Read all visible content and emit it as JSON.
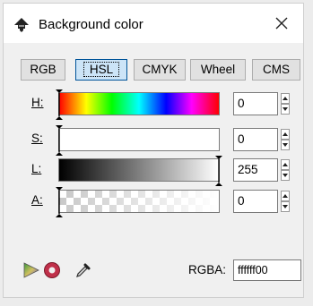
{
  "window": {
    "title": "Background color",
    "close_icon": "close-icon"
  },
  "tabs": [
    {
      "label": "RGB",
      "active": false
    },
    {
      "label": "HSL",
      "active": true
    },
    {
      "label": "CMYK",
      "active": false
    },
    {
      "label": "Wheel",
      "active": false
    },
    {
      "label": "CMS",
      "active": false
    }
  ],
  "channels": [
    {
      "key": "h",
      "label": "H:",
      "value": "0",
      "marker_fraction": 0
    },
    {
      "key": "s",
      "label": "S:",
      "value": "0",
      "marker_fraction": 0
    },
    {
      "key": "l",
      "label": "L:",
      "value": "255",
      "marker_fraction": 1
    },
    {
      "key": "a",
      "label": "A:",
      "value": "0",
      "marker_fraction": 0
    }
  ],
  "tools": {
    "gamut_icon": "out-of-gamut-icon",
    "no_paint_icon": "no-paint-icon",
    "picker_icon": "eyedropper-icon"
  },
  "rgba": {
    "label": "RGBA:",
    "value": "ffffff00"
  },
  "colors": {
    "active_tab": "#cce4f7",
    "active_tab_border": "#005499",
    "window_bg": "#f0f0f0"
  }
}
